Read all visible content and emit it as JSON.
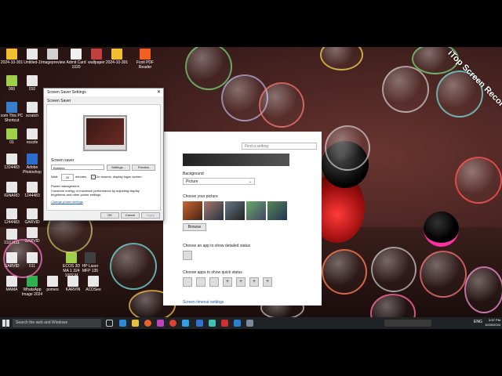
{
  "watermark": "iTop Screen Recorder",
  "desktop_icons": [
    {
      "label": "2024-10-301",
      "color": "#f0c030"
    },
    {
      "label": "Untitled-1",
      "color": "#e8e8e8"
    },
    {
      "label": "Imagepreview",
      "color": "#d0d0d0"
    },
    {
      "label": "Admit Card 1020",
      "color": "#f0f0f0"
    },
    {
      "label": "wallpaper",
      "color": "#c04040"
    },
    {
      "label": "2024-10-301",
      "color": "#f0c030"
    },
    {
      "label": "Foxit PDF Reader",
      "color": "#f06020"
    },
    {
      "label": "000",
      "color": "#9fd04a"
    },
    {
      "label": "010",
      "color": "#e8e8e8"
    },
    {
      "label": "com This PC Shortcut",
      "color": "#3a7dc9"
    },
    {
      "label": "scratch",
      "color": "#e8e8e8"
    },
    {
      "label": "nozzle",
      "color": "#e8e8e8"
    },
    {
      "label": "01",
      "color": "#9fd04a"
    },
    {
      "label": "Adobe Photoshop",
      "color": "#2a6fd0"
    },
    {
      "label": "1324483",
      "color": "#e8e8e8"
    },
    {
      "label": "IGNARD",
      "color": "#e8e8e8"
    },
    {
      "label": "1244483",
      "color": "#e8e8e8"
    },
    {
      "label": "1244483",
      "color": "#e8e8e8"
    },
    {
      "label": "GARVID",
      "color": "#e8e8e8"
    },
    {
      "label": "GARVID",
      "color": "#e8e8e8"
    },
    {
      "label": "11111111",
      "color": "#e8e8e8"
    },
    {
      "label": "011",
      "color": "#e8e8e8"
    },
    {
      "label": "GARVID",
      "color": "#e8e8e8"
    },
    {
      "label": "ECOS 3D MA 1 324 1002 M",
      "color": "#9fd04a"
    },
    {
      "label": "HP Laser MFP 135",
      "color": "#404040"
    },
    {
      "label": "MAMA",
      "color": "#e8e8e8"
    },
    {
      "label": "WhatsApp Image 2024",
      "color": "#30b050"
    },
    {
      "label": "pomeo",
      "color": "#e8e8e8"
    },
    {
      "label": "KARVIN",
      "color": "#e8e8e8"
    },
    {
      "label": "ACDSee",
      "color": "#e8e8e8"
    }
  ],
  "screensaver_dialog": {
    "title": "Screen Saver Settings",
    "tab": "Screen Saver",
    "screen_saver_label": "Screen saver",
    "screen_saver_value": "Bubbles",
    "settings_button": "Settings...",
    "preview_button": "Preview",
    "wait_label": "Wait:",
    "wait_value": "20",
    "minutes_label": "minutes",
    "resume_label": "On resume, display logon screen",
    "power_title": "Power management",
    "power_text": "Conserve energy or maximize performance by adjusting display brightness and other power settings.",
    "power_link": "Change power settings",
    "ok": "OK",
    "cancel": "Cancel",
    "apply": "Apply"
  },
  "settings_window": {
    "search_placeholder": "Find a setting",
    "background_label": "Background",
    "background_value": "Picture",
    "choose_picture": "Choose your picture",
    "browse": "Browse",
    "detailed_status": "Choose an app to show detailed status",
    "quick_status": "Choose apps to show quick status",
    "footer_link": "Screen timeout settings"
  },
  "taskbar": {
    "search_placeholder": "Search the web and Windows",
    "language": "ENG",
    "time": "5:57 PM",
    "date": "10/30/2024"
  }
}
